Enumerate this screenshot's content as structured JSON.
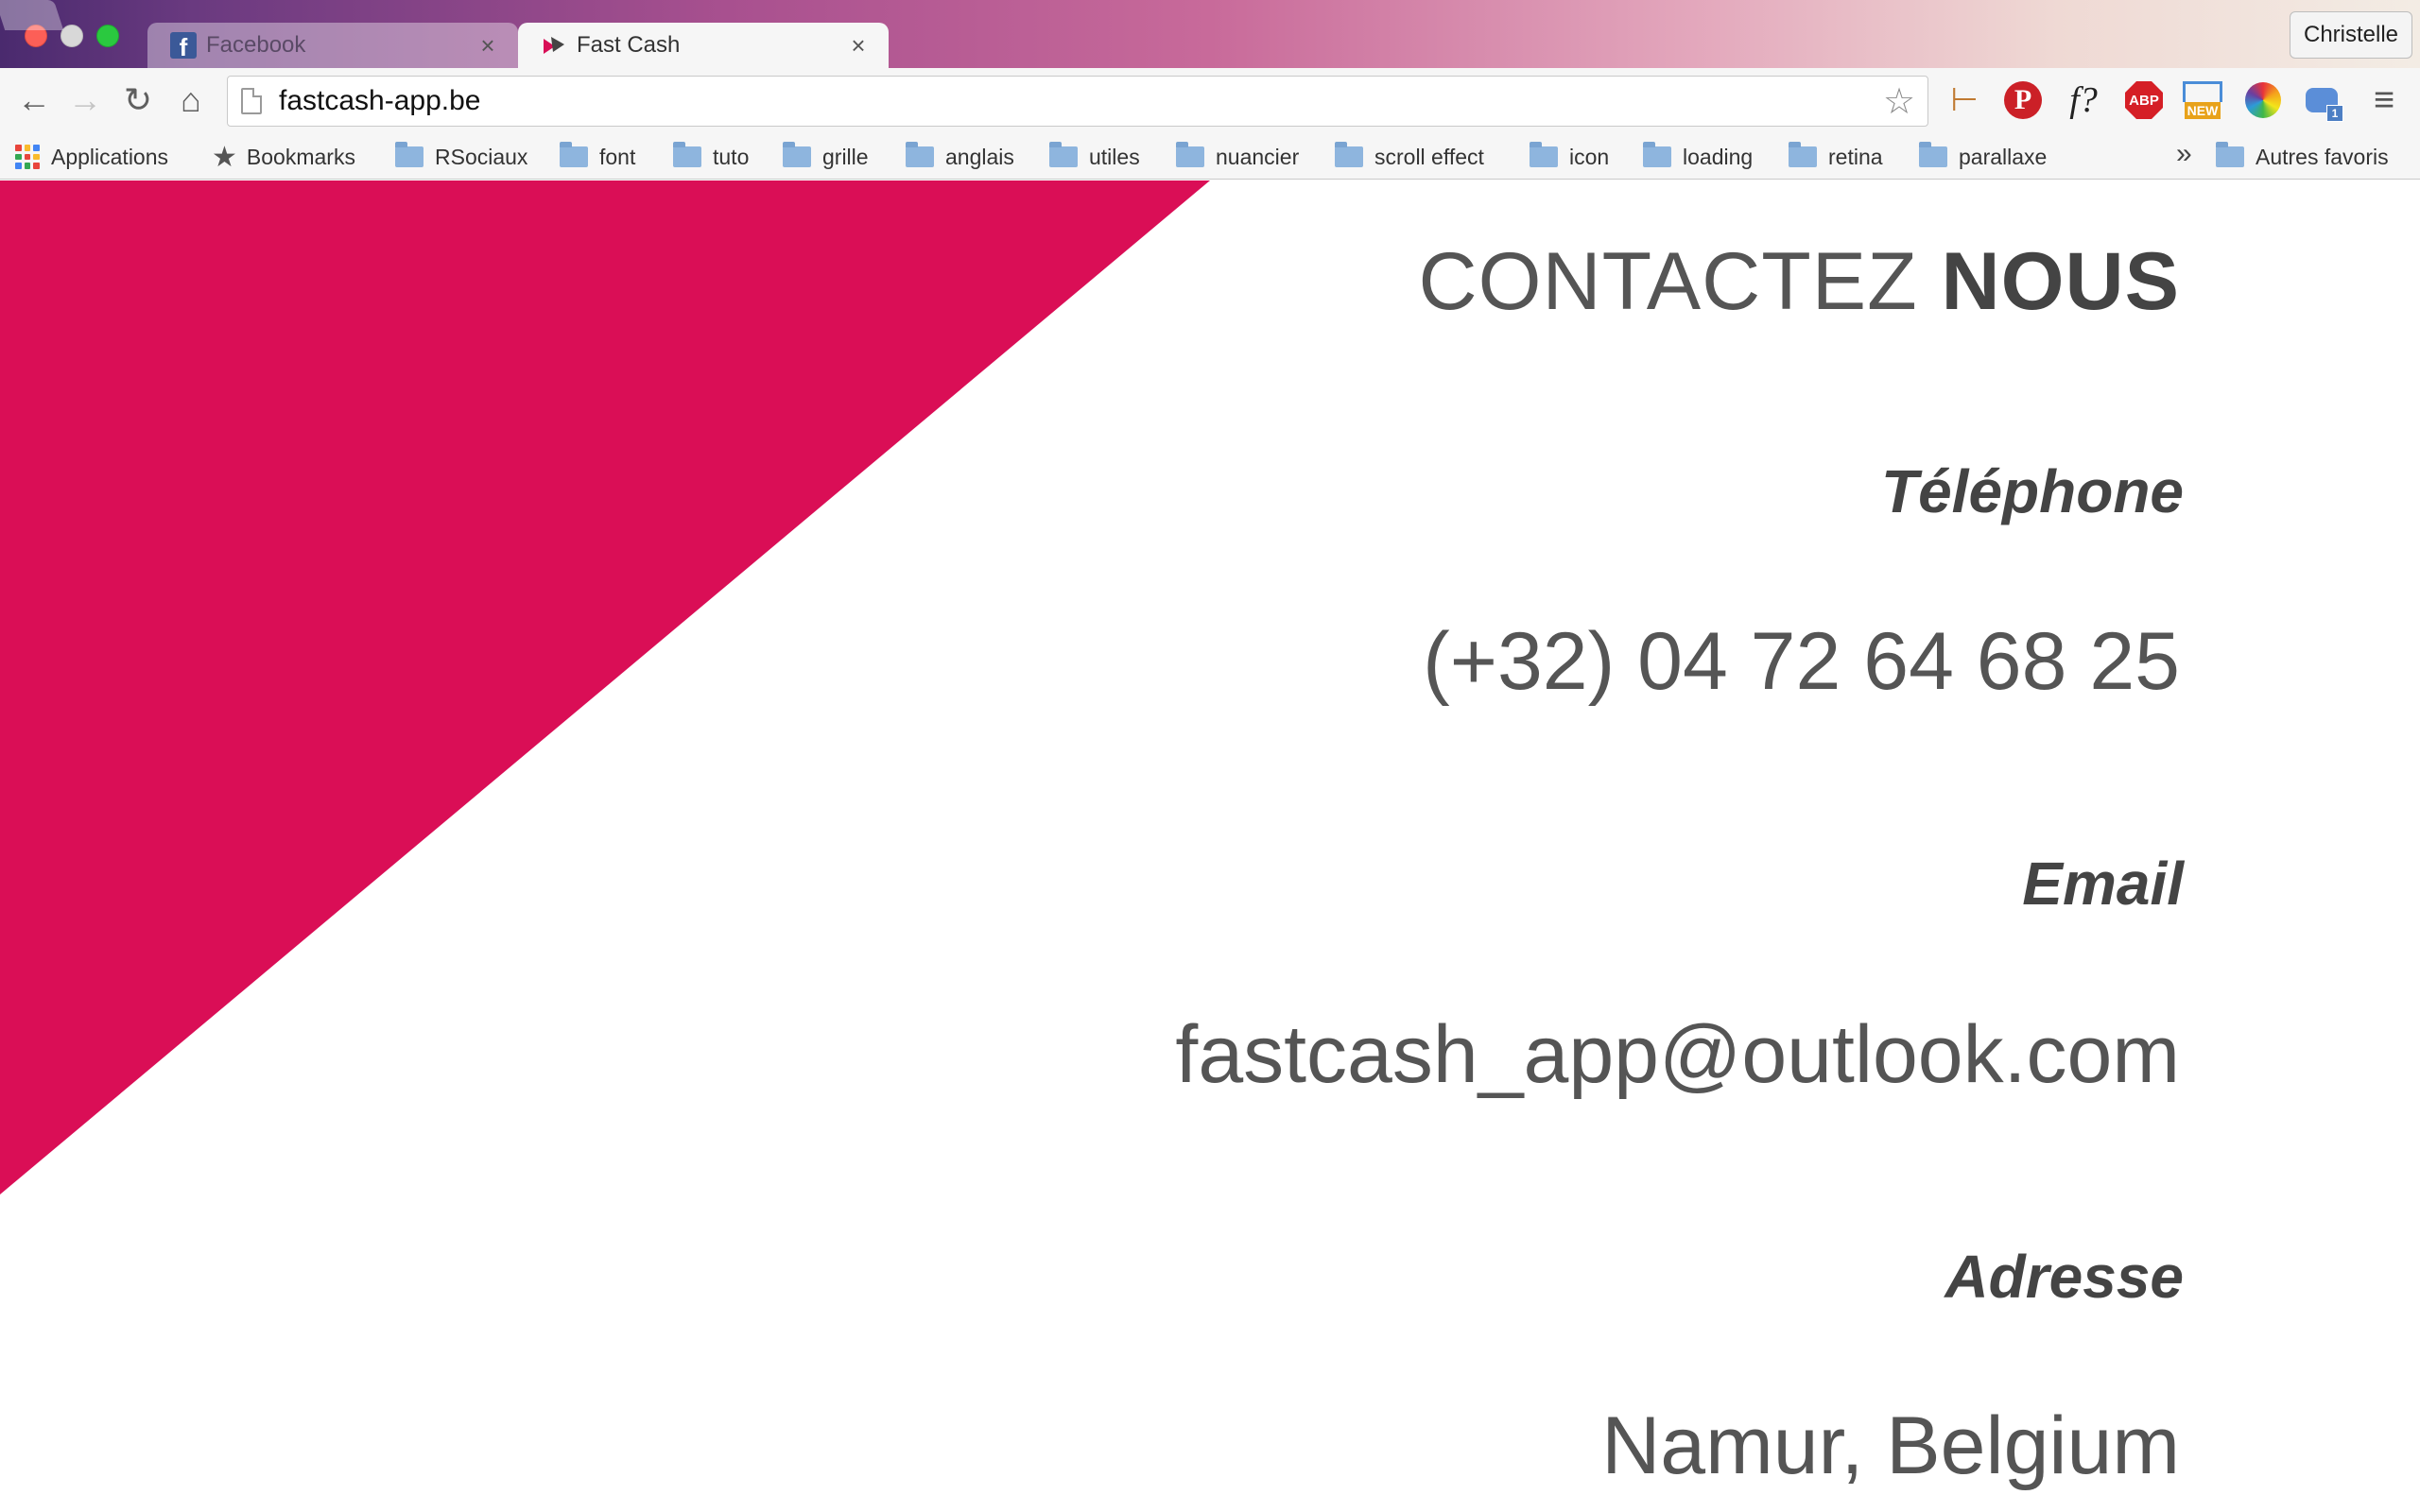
{
  "browser": {
    "tabs": [
      {
        "title": "Facebook",
        "favicon": "facebook-icon",
        "active": false
      },
      {
        "title": "Fast Cash",
        "favicon": "fastcash-icon",
        "active": true
      }
    ],
    "close_glyph": "×",
    "profile_name": "Christelle",
    "address_bar": {
      "url": "fastcash-app.be"
    },
    "nav_glyphs": {
      "back": "←",
      "forward": "→",
      "reload": "↻",
      "home": "⌂",
      "star": "☆",
      "menu": "≡"
    },
    "extensions": [
      {
        "name": "ruler-extension-icon",
        "glyph": "⊢"
      },
      {
        "name": "pinterest-icon",
        "glyph": "P"
      },
      {
        "name": "whatfont-icon",
        "glyph": "f?"
      },
      {
        "name": "adblock-plus-icon",
        "glyph": "ABP"
      },
      {
        "name": "new-tab-extension-icon",
        "badge": "NEW"
      },
      {
        "name": "color-wheel-icon"
      },
      {
        "name": "chat-extension-icon",
        "badge": "1"
      }
    ],
    "bookmarks": [
      {
        "label": "Applications",
        "type": "apps"
      },
      {
        "label": "Bookmarks",
        "type": "star"
      },
      {
        "label": "RSociaux",
        "type": "folder"
      },
      {
        "label": "font",
        "type": "folder"
      },
      {
        "label": "tuto",
        "type": "folder"
      },
      {
        "label": "grille",
        "type": "folder"
      },
      {
        "label": "anglais",
        "type": "folder"
      },
      {
        "label": "utiles",
        "type": "folder"
      },
      {
        "label": "nuancier",
        "type": "folder"
      },
      {
        "label": "scroll effect",
        "type": "folder"
      },
      {
        "label": "icon",
        "type": "folder"
      },
      {
        "label": "loading",
        "type": "folder"
      },
      {
        "label": "retina",
        "type": "folder"
      },
      {
        "label": "parallaxe",
        "type": "folder"
      }
    ],
    "bookmarks_overflow": "»",
    "other_bookmarks": "Autres favoris"
  },
  "page": {
    "heading_light": "CONTACTEZ",
    "heading_bold": "NOUS",
    "phone_label": "Téléphone",
    "phone_value": "(+32) 04 72 64 68 25",
    "email_label": "Email",
    "email_value": "fastcash_app@outlook.com",
    "address_label": "Adresse",
    "address_value": "Namur, Belgium",
    "accent_color": "#da0e56"
  }
}
